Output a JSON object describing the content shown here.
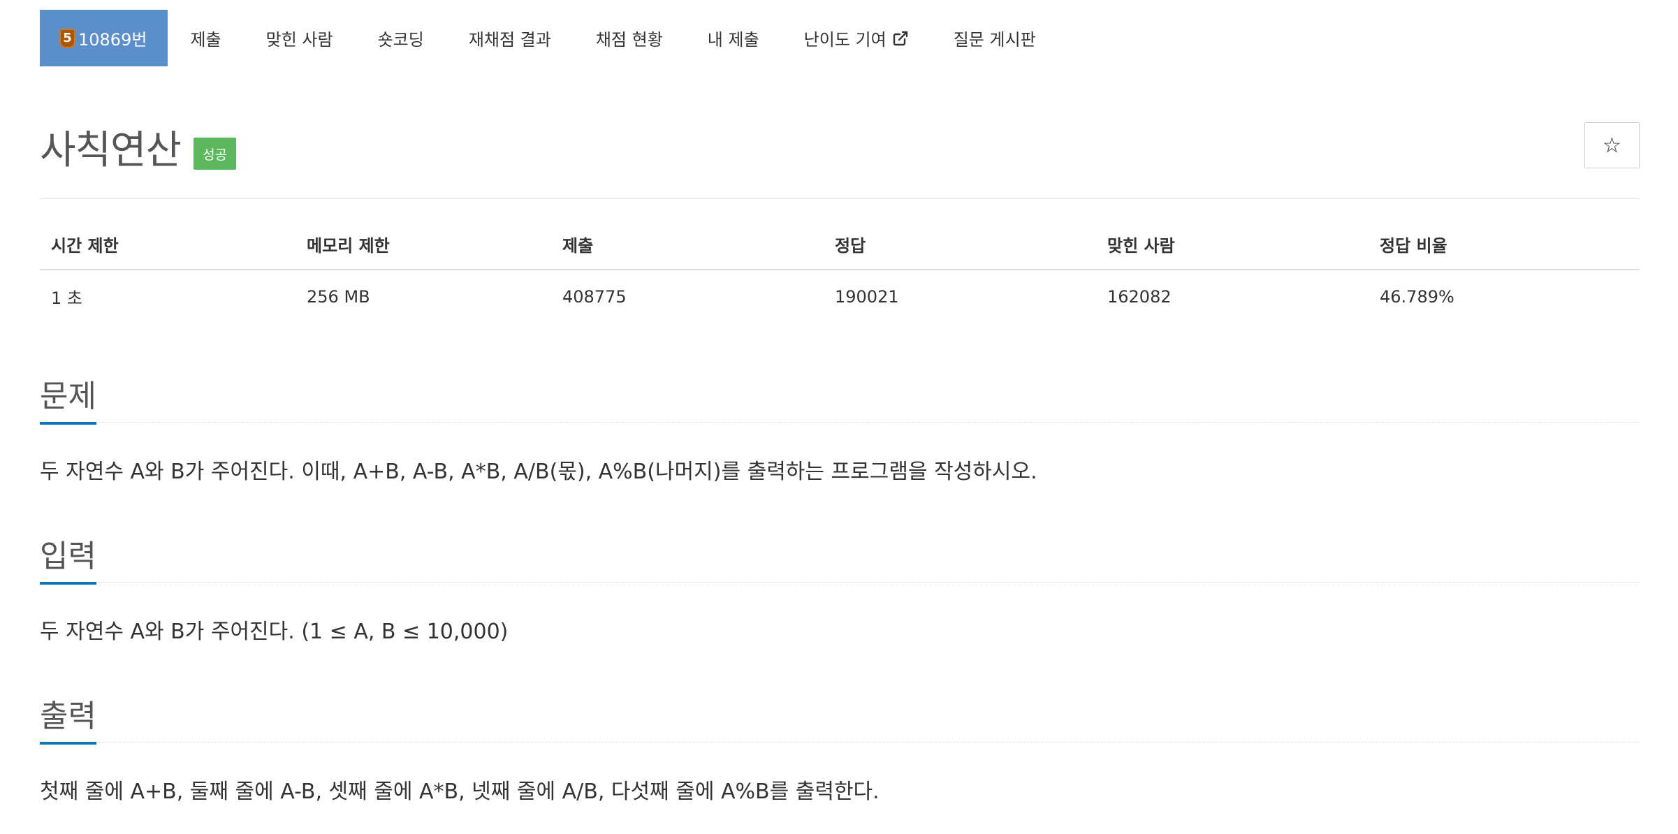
{
  "nav": {
    "problem": {
      "tier": "5",
      "label": "10869번"
    },
    "items": [
      {
        "label": "제출"
      },
      {
        "label": "맞힌 사람"
      },
      {
        "label": "숏코딩"
      },
      {
        "label": "재채점 결과"
      },
      {
        "label": "채점 현황"
      },
      {
        "label": "내 제출"
      },
      {
        "label": "난이도 기여"
      },
      {
        "label": "질문 게시판"
      }
    ]
  },
  "problem": {
    "title": "사칙연산",
    "badge": "성공",
    "star": "☆"
  },
  "info": {
    "headers": [
      "시간 제한",
      "메모리 제한",
      "제출",
      "정답",
      "맞힌 사람",
      "정답 비율"
    ],
    "values": [
      "1 초",
      "256 MB",
      "408775",
      "190021",
      "162082",
      "46.789%"
    ]
  },
  "sections": {
    "description": {
      "title": "문제",
      "text": "두 자연수 A와 B가 주어진다. 이때, A+B, A-B, A*B, A/B(몫), A%B(나머지)를 출력하는 프로그램을 작성하시오."
    },
    "input": {
      "title": "입력",
      "text": "두 자연수 A와 B가 주어진다. (1 ≤ A, B ≤ 10,000)"
    },
    "output": {
      "title": "출력",
      "text": "첫째 줄에 A+B, 둘째 줄에 A-B, 셋째 줄에 A*B, 넷째 줄에 A/B, 다섯째 줄에 A%B를 출력한다."
    }
  },
  "colors": {
    "nav_active": "#5b8fcc",
    "badge_success": "#5cb85c",
    "section_accent": "#0e76b8",
    "tier_bronze": "#ad5600"
  },
  "icons": {
    "tier": "bronze-tier-icon",
    "external": "external-link-icon",
    "star": "star-outline-icon"
  }
}
